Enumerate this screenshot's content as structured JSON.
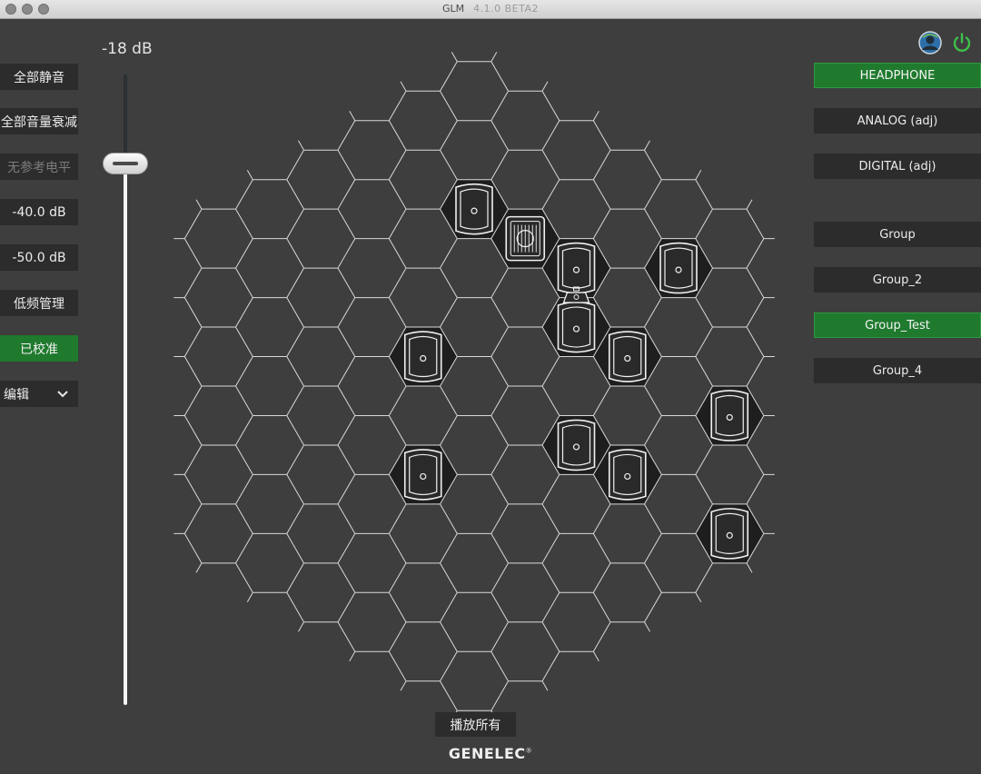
{
  "window": {
    "title": "GLM",
    "version": "4.1.0 BETA2"
  },
  "left_panel": {
    "buttons": [
      {
        "label": "全部静音"
      },
      {
        "label": "全部音量衰减"
      },
      {
        "label": "无参考电平"
      },
      {
        "label": "-40.0 dB"
      },
      {
        "label": "-50.0 dB"
      },
      {
        "label": "低频管理"
      },
      {
        "label": "已校准"
      }
    ],
    "edit_select": {
      "label": "编辑",
      "icon": "chevron-down-icon"
    }
  },
  "volume": {
    "label": "-18 dB",
    "fader_level": 0.85
  },
  "right_panel": {
    "outputs": [
      {
        "label": "HEADPHONE",
        "active": true
      },
      {
        "label": "ANALOG (adj)",
        "active": false
      },
      {
        "label": "DIGITAL (adj)",
        "active": false
      }
    ],
    "groups": [
      {
        "label": "Group",
        "active": false
      },
      {
        "label": "Group_2",
        "active": false
      },
      {
        "label": "Group_Test",
        "active": true
      },
      {
        "label": "Group_4",
        "active": false
      }
    ],
    "icons": [
      "user-profile-icon",
      "power-icon"
    ]
  },
  "speaker_map": {
    "speakers": [
      {
        "q": 0,
        "r": -3,
        "kind": "monitor"
      },
      {
        "q": 1,
        "r": -3,
        "kind": "subwoofer"
      },
      {
        "q": 2,
        "r": -3,
        "kind": "monitor"
      },
      {
        "q": 4,
        "r": -4,
        "kind": "monitor"
      },
      {
        "q": 2,
        "r": -2,
        "kind": "monitor"
      },
      {
        "q": 3,
        "r": -2,
        "kind": "monitor"
      },
      {
        "q": -1,
        "r": 0,
        "kind": "monitor"
      },
      {
        "q": 5,
        "r": -2,
        "kind": "monitor"
      },
      {
        "q": 2,
        "r": 0,
        "kind": "monitor"
      },
      {
        "q": 3,
        "r": 0,
        "kind": "monitor"
      },
      {
        "q": -1,
        "r": 2,
        "kind": "monitor"
      },
      {
        "q": 5,
        "r": 0,
        "kind": "monitor"
      }
    ],
    "adapter": {
      "q": 2,
      "r": -2,
      "kind": "glm-adapter"
    }
  },
  "footer": {
    "play_all_label": "播放所有",
    "brand": "GENELEC",
    "brand_mark": "®"
  },
  "colors": {
    "background": "#3e3e3e",
    "button": "#2c2c2c",
    "active_green": "#1f7a2e",
    "hex_line": "#d9d9d9",
    "speaker_cell": "#1e1e1e",
    "power_green": "#3fbf4a"
  }
}
